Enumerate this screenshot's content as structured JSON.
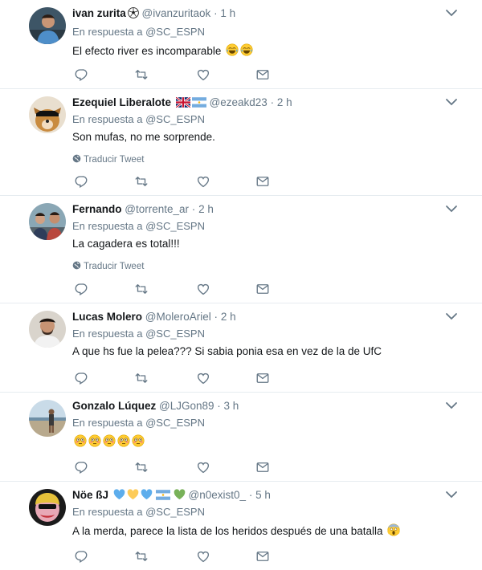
{
  "reply_prefix": "En respuesta a",
  "translate_label": "Traducir Tweet",
  "colors": {
    "icon": "#657786",
    "text": "#14171a",
    "muted": "#657786",
    "border": "#e6ecf0"
  },
  "tweets": [
    {
      "name": "ivan zurita",
      "handle": "@ivanzuritaok",
      "sep": "·",
      "time": "1 h",
      "reply_to": "@SC_ESPN",
      "text": "El efecto river es incomparable",
      "name_icons": [
        "soccer-ball-icon"
      ],
      "text_emoji": [
        "joy-emoji",
        "joy-emoji"
      ],
      "translate": false
    },
    {
      "name": "Ezequiel Liberalote",
      "handle": "@ezeakd23",
      "sep": "·",
      "time": "2 h",
      "reply_to": "@SC_ESPN",
      "text": "Son mufas, no me sorprende.",
      "name_icons": [
        "uk-flag-icon",
        "argentina-flag-icon"
      ],
      "text_emoji": [],
      "translate": true
    },
    {
      "name": "Fernando",
      "handle": "@torrente_ar",
      "sep": "·",
      "time": "2 h",
      "reply_to": "@SC_ESPN",
      "text": "La cagadera es total!!!",
      "name_icons": [],
      "text_emoji": [],
      "translate": true
    },
    {
      "name": "Lucas Molero",
      "handle": "@MoleroAriel",
      "sep": "·",
      "time": "2 h",
      "reply_to": "@SC_ESPN",
      "text": "A que hs fue la pelea??? Si sabia ponia esa en vez de la de UfC",
      "name_icons": [],
      "text_emoji": [],
      "translate": false
    },
    {
      "name": "Gonzalo Lúquez",
      "handle": "@LJGon89",
      "sep": "·",
      "time": "3 h",
      "reply_to": "@SC_ESPN",
      "text": "",
      "name_icons": [],
      "text_emoji": [
        "flushed-emoji",
        "flushed-emoji",
        "flushed-emoji",
        "flushed-emoji",
        "flushed-emoji"
      ],
      "translate": false
    },
    {
      "name": "Nöe ßJ",
      "handle": "@n0exist0_",
      "sep": "·",
      "time": "5 h",
      "reply_to": "@SC_ESPN",
      "text": "A la merda, parece la lista de los heridos después de una batalla",
      "name_icons": [
        "blue-heart-icon",
        "yellow-heart-icon",
        "blue-heart-icon",
        "argentina-flag-icon",
        "green-heart-icon"
      ],
      "text_emoji": [
        "scream-emoji"
      ],
      "translate": false
    }
  ]
}
